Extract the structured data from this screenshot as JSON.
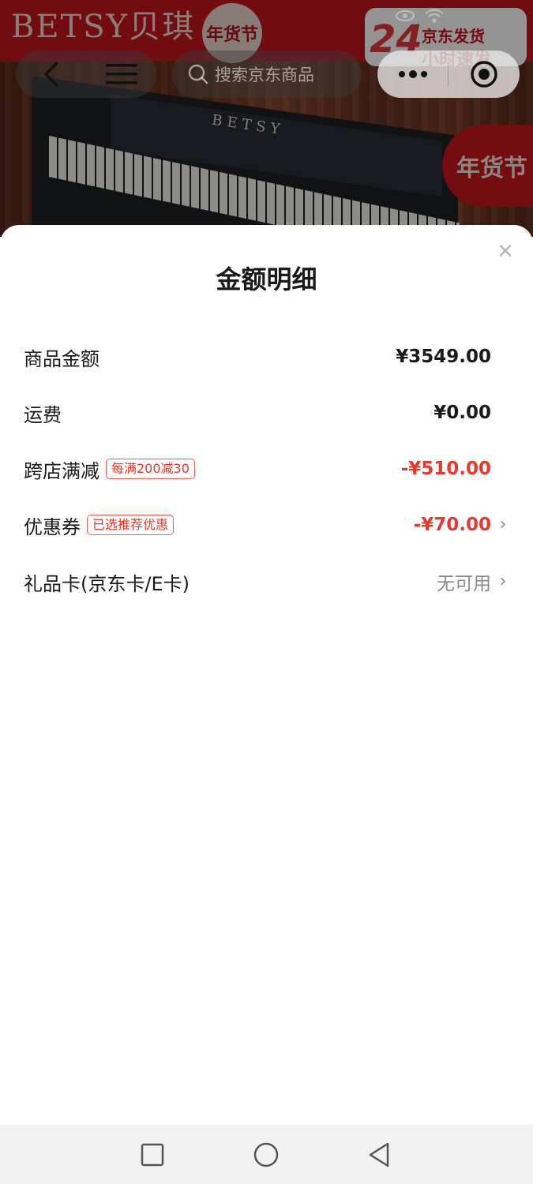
{
  "background": {
    "brand_text": "BETSY贝琪",
    "brand_cross": "x",
    "festival_text": "年货节",
    "promo_number": "24",
    "promo_line1": "京东发货",
    "promo_line2": "小时速发",
    "piano_brand": "BETSY",
    "festival_bubble": "年货节"
  },
  "top_nav": {
    "search_placeholder": "搜索京东商品"
  },
  "sheet": {
    "title": "金额明细",
    "close_icon": "×",
    "rows": [
      {
        "label": "商品金额",
        "tag": "",
        "value": "¥3549.00",
        "value_style": "normal",
        "has_chevron": false
      },
      {
        "label": "运费",
        "tag": "",
        "value": "¥0.00",
        "value_style": "normal",
        "has_chevron": false
      },
      {
        "label": "跨店满减",
        "tag": "每满200减30",
        "value": "-¥510.00",
        "value_style": "negative",
        "has_chevron": false
      },
      {
        "label": "优惠券",
        "tag": "已选推荐优惠",
        "value": "-¥70.00",
        "value_style": "negative",
        "has_chevron": true
      },
      {
        "label": "礼品卡(京东卡/E卡)",
        "tag": "",
        "value": "无可用",
        "value_style": "muted",
        "has_chevron": true
      }
    ],
    "chevron": "›"
  },
  "colors": {
    "accent_red": "#e8392e",
    "tag_border": "#f0614f",
    "text_primary": "#1a1a1a",
    "text_muted": "#8a8a8a"
  }
}
